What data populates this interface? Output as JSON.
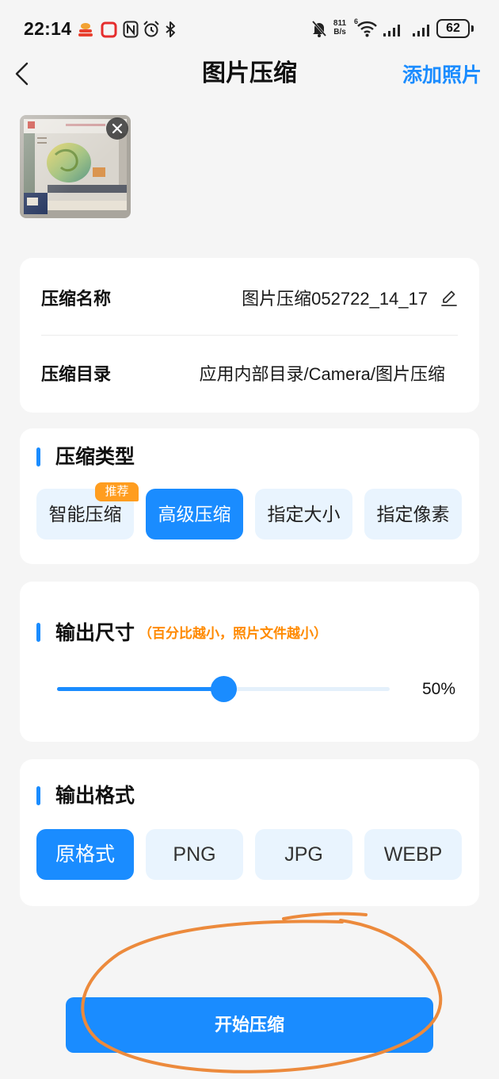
{
  "status_bar": {
    "time": "22:14",
    "net_speed": "811",
    "net_speed_unit": "B/s",
    "wifi_generation": "6",
    "battery_level": "62",
    "left_icons": [
      "app-notification-icon",
      "square-notification-icon",
      "nfc-icon",
      "alarm-icon",
      "bluetooth-icon"
    ],
    "right_icons": [
      "mute-icon",
      "wifi-icon",
      "signal-icon",
      "signal-icon",
      "battery-icon"
    ]
  },
  "header": {
    "back_icon": "chevron-left-icon",
    "title": "图片压缩",
    "add_photo": "添加照片"
  },
  "photos": [
    {
      "remove_icon": "close-icon"
    }
  ],
  "info": {
    "name_label": "压缩名称",
    "name_value": "图片压缩052722_14_17",
    "edit_icon": "pencil-icon",
    "dir_label": "压缩目录",
    "dir_value": "应用内部目录/Camera/图片压缩"
  },
  "compress_type": {
    "title": "压缩类型",
    "options": [
      {
        "label": "智能压缩",
        "badge": "推荐",
        "selected": false
      },
      {
        "label": "高级压缩",
        "selected": true
      },
      {
        "label": "指定大小",
        "selected": false
      },
      {
        "label": "指定像素",
        "selected": false
      }
    ]
  },
  "output_size": {
    "title": "输出尺寸",
    "hint": "（百分比越小，照片文件越小）",
    "percent": 0.5,
    "percent_label": "50%"
  },
  "output_format": {
    "title": "输出格式",
    "options": [
      {
        "label": "原格式",
        "selected": true
      },
      {
        "label": "PNG",
        "selected": false
      },
      {
        "label": "JPG",
        "selected": false
      },
      {
        "label": "WEBP",
        "selected": false
      }
    ]
  },
  "start_button": "开始压缩",
  "colors": {
    "accent": "#1a8cff",
    "option_bg": "#e9f4fe",
    "track_bg": "#e4f0fb",
    "badge": "#ff9d1f",
    "hint": "#ff8a00",
    "annotation": "#ec8a3c",
    "page_bg": "#f5f5f5"
  }
}
